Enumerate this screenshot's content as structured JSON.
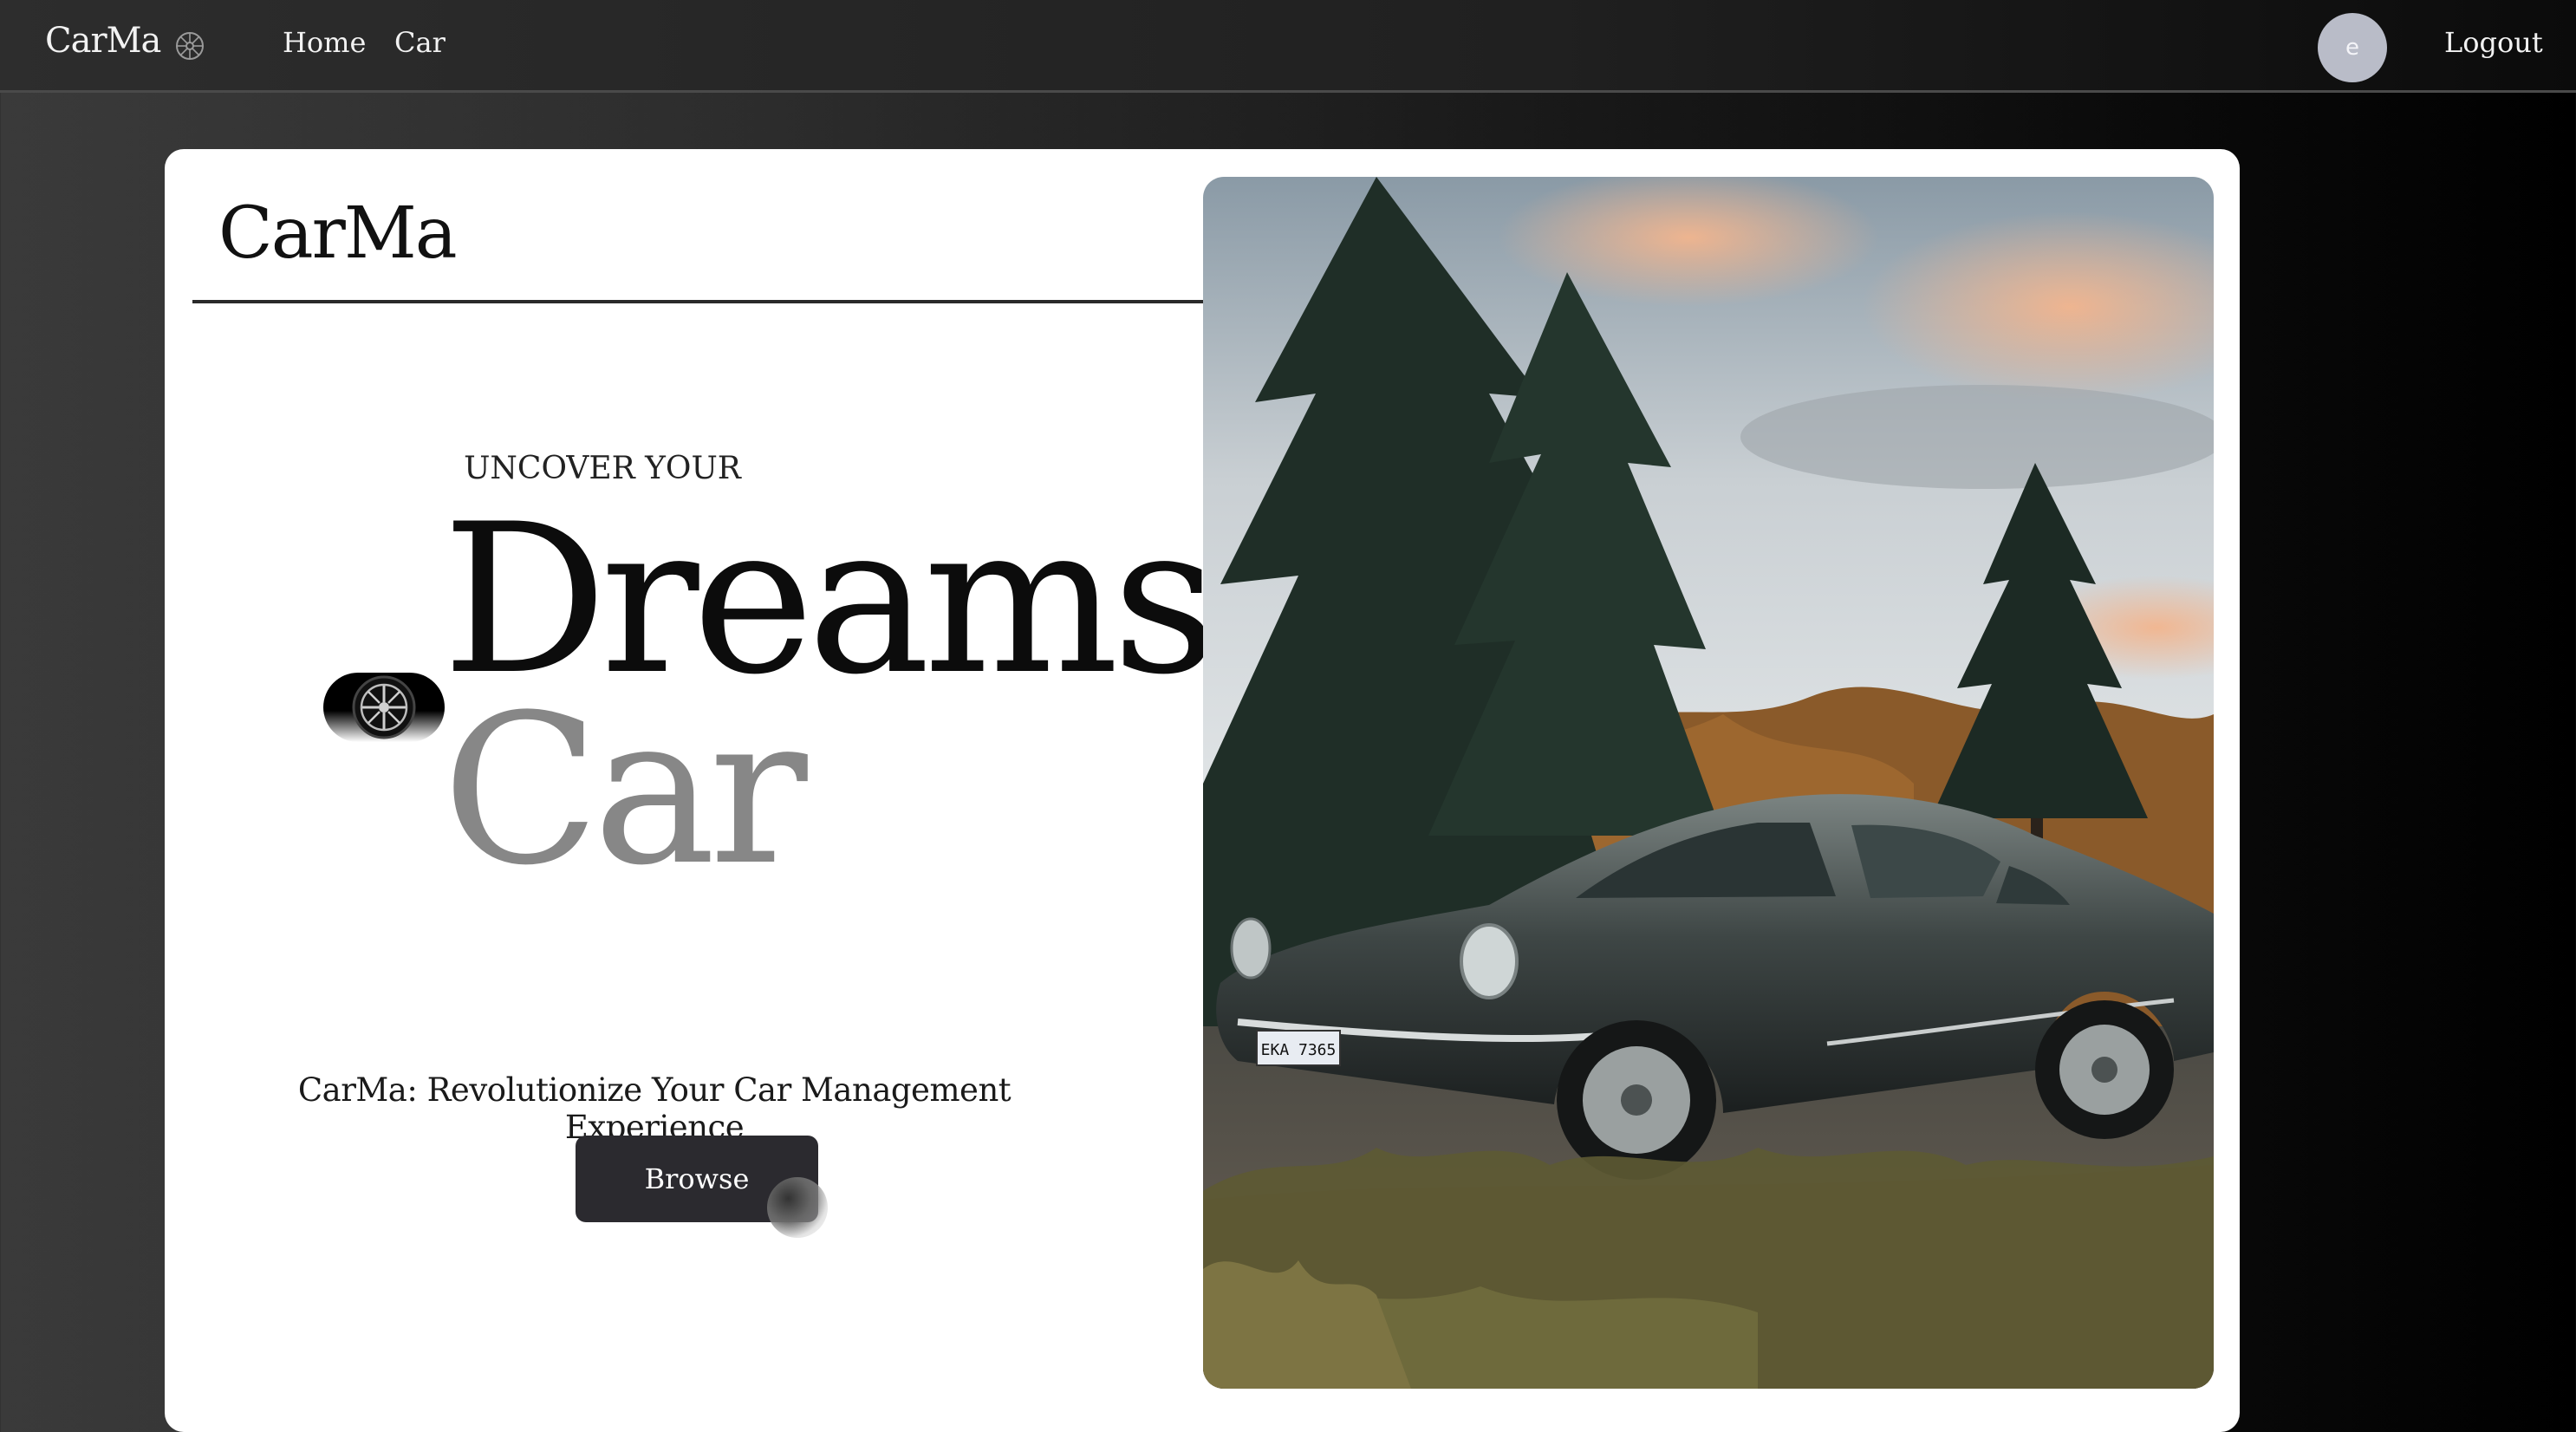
{
  "nav": {
    "brand": "CarMa",
    "brand_icon": "wheel-icon",
    "links": [
      "Home",
      "Car"
    ],
    "avatar_initial": "e",
    "logout": "Logout"
  },
  "hero": {
    "card_title": "CarMa",
    "eyebrow": "UNCOVER YOUR",
    "headline_1": "Dreams",
    "headline_2": "Car",
    "tagline": "CarMa: Revolutionize Your Car Management Experience",
    "cta": "Browse",
    "pill_icon": "wheel-icon",
    "image": {
      "plate_text": "EKA 7365"
    }
  },
  "colors": {
    "accent_dark": "#2b2a2f",
    "headline_primary": "#0c0c0c",
    "headline_secondary": "#878787",
    "avatar_bg": "#b9bcc8"
  }
}
